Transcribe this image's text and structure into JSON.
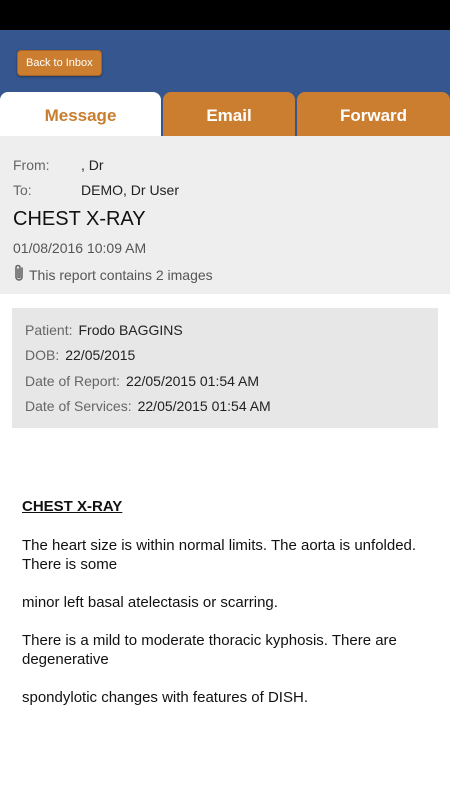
{
  "header": {
    "back_label": "Back to Inbox"
  },
  "tabs": [
    {
      "label": "Message"
    },
    {
      "label": "Email"
    },
    {
      "label": "Forward"
    }
  ],
  "message": {
    "from_key": "From:",
    "from_value": ", Dr",
    "to_key": "To:",
    "to_value": "DEMO, Dr User",
    "subject": "CHEST X-RAY",
    "datetime": "01/08/2016 10:09 AM",
    "attachment_note": "This report contains 2 images"
  },
  "patient": {
    "name_key": "Patient:",
    "name": "Frodo BAGGINS",
    "dob_key": "DOB:",
    "dob": "22/05/2015",
    "report_date_key": "Date of Report:",
    "report_date": "22/05/2015 01:54 AM",
    "service_date_key": "Date of Services:",
    "service_date": "22/05/2015 01:54 AM"
  },
  "report": {
    "title": "CHEST X-RAY",
    "paragraphs": [
      "The heart size is within normal limits. The aorta is unfolded. There is some",
      "minor left basal atelectasis or scarring.",
      "There is a mild to moderate thoracic kyphosis. There are degenerative",
      "spondylotic changes with features of DISH."
    ]
  },
  "icons": {
    "attachment": "paperclip-icon"
  }
}
